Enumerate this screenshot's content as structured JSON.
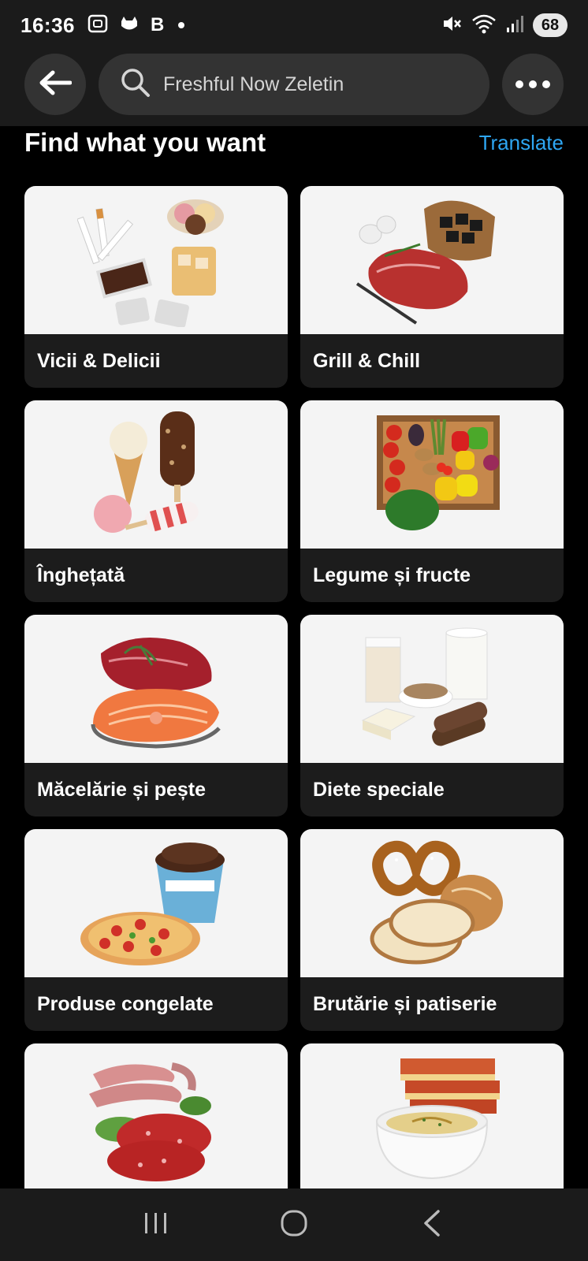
{
  "status_bar": {
    "time": "16:36",
    "left_icons": [
      "screenshot-icon",
      "cat-face-icon",
      "B",
      "dot"
    ],
    "b_label": "B",
    "right_icons": [
      "mute-icon",
      "wifi-icon",
      "signal-icon"
    ],
    "battery": "68"
  },
  "app_bar": {
    "search_text": "Freshful Now Zeletin",
    "icons": [
      "back-arrow-icon",
      "search-icon",
      "more-options-icon"
    ]
  },
  "section": {
    "title": "Find what you want",
    "translate": "Translate"
  },
  "categories": [
    {
      "label": "Vicii & Delicii",
      "image": "cigarettes-chocolate-icecream-whisky"
    },
    {
      "label": "Grill & Chill",
      "image": "steak-charcoal-garlic"
    },
    {
      "label": "Înghețată",
      "image": "ice-cream-cone-popsicles"
    },
    {
      "label": "Legume și fructe",
      "image": "vegetable-crate"
    },
    {
      "label": "Măcelărie și pește",
      "image": "beef-and-salmon"
    },
    {
      "label": "Diete speciale",
      "image": "milk-tofu-bread"
    },
    {
      "label": "Produse congelate",
      "image": "pizza-and-ice-cream-tub"
    },
    {
      "label": "Brutărie și patiserie",
      "image": "pretzel-and-bread"
    },
    {
      "label": "",
      "image": "sausages-salami"
    },
    {
      "label": "",
      "image": "lasagna-hummus"
    }
  ],
  "nav_bar": {
    "icons": [
      "recent-apps-icon",
      "home-icon",
      "back-icon"
    ]
  },
  "colors": {
    "background": "#000000",
    "bar": "#1b1b1b",
    "pill": "#333333",
    "card_label_bg": "#1c1c1c",
    "accent": "#2ea6f2"
  }
}
